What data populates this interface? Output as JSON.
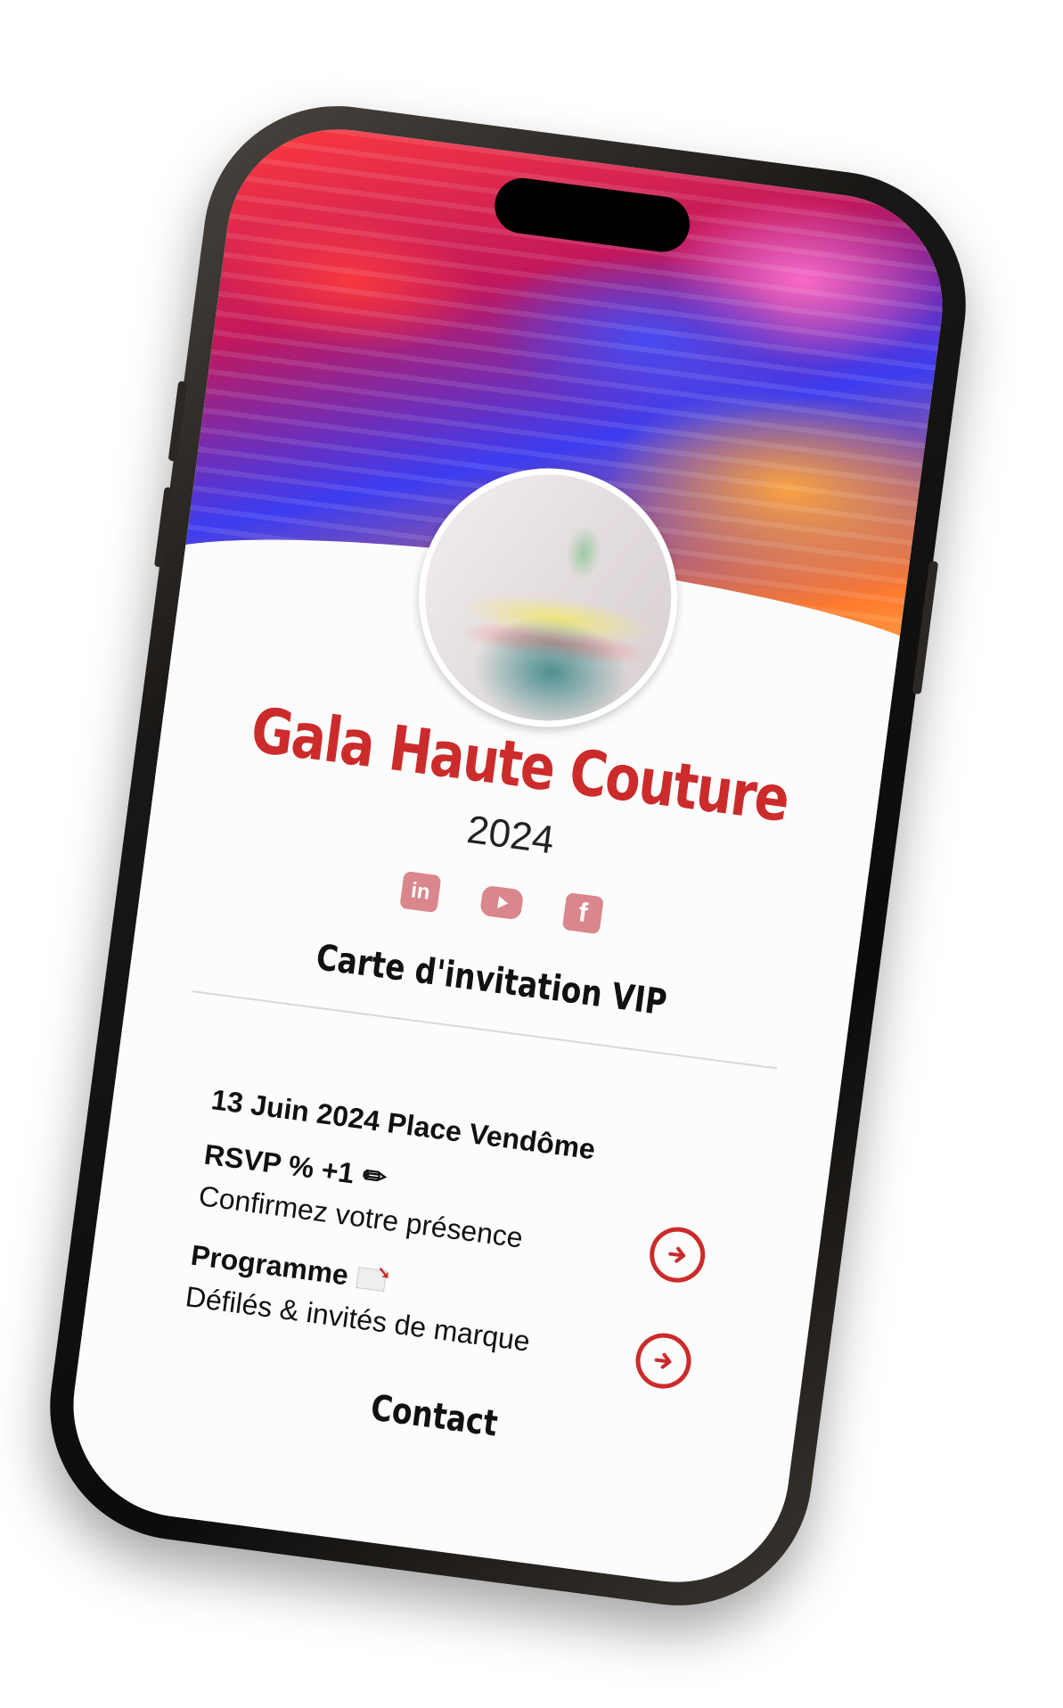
{
  "event": {
    "title": "Gala Haute Couture",
    "year": "2024"
  },
  "socials": [
    {
      "icon": "linkedin-icon",
      "label": "in"
    },
    {
      "icon": "youtube-icon",
      "label": ""
    },
    {
      "icon": "facebook-icon",
      "label": "f"
    }
  ],
  "card": {
    "subtitle": "Carte d'invitation VIP",
    "date_location": "13 Juin 2024 Place Vendôme"
  },
  "rsvp": {
    "title": "RSVP % +1",
    "description": "Confirmez votre présence"
  },
  "program": {
    "title": "Programme",
    "description": "Défilés & invités de marque"
  },
  "contact": {
    "title": "Contact"
  },
  "colors": {
    "accent": "#cc2b2b",
    "social": "#d9878c"
  }
}
